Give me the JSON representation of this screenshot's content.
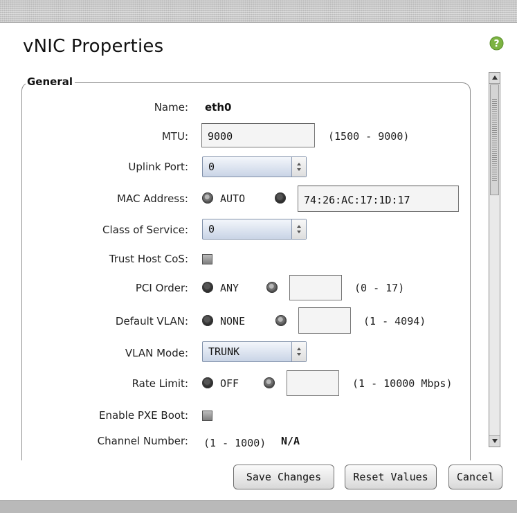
{
  "dialog": {
    "title": "vNIC Properties",
    "help_icon": "question-circle-icon"
  },
  "section": {
    "legend": "General"
  },
  "fields": {
    "name": {
      "label": "Name:",
      "value": "eth0"
    },
    "mtu": {
      "label": "MTU:",
      "value": "9000",
      "hint": "(1500 - 9000)"
    },
    "uplink_port": {
      "label": "Uplink Port:",
      "value": "0"
    },
    "mac_address": {
      "label": "MAC Address:",
      "option_auto": "AUTO",
      "auto_selected": false,
      "custom_selected": true,
      "value": "74:26:AC:17:1D:17"
    },
    "class_of_service": {
      "label": "Class of Service:",
      "value": "0"
    },
    "trust_host_cos": {
      "label": "Trust Host CoS:",
      "checked": false
    },
    "pci_order": {
      "label": "PCI Order:",
      "option_any": "ANY",
      "any_selected": true,
      "value": "",
      "hint": "(0 - 17)"
    },
    "default_vlan": {
      "label": "Default VLAN:",
      "option_none": "NONE",
      "none_selected": true,
      "value": "",
      "hint": "(1 - 4094)"
    },
    "vlan_mode": {
      "label": "VLAN Mode:",
      "value": "TRUNK"
    },
    "rate_limit": {
      "label": "Rate Limit:",
      "option_off": "OFF",
      "off_selected": true,
      "value": "",
      "hint": "(1 - 10000 Mbps)"
    },
    "enable_pxe_boot": {
      "label": "Enable PXE Boot:",
      "checked": false
    },
    "channel_number": {
      "label": "Channel Number:",
      "hint": "(1 - 1000)",
      "value": "N/A"
    }
  },
  "buttons": {
    "save": "Save Changes",
    "reset": "Reset Values",
    "cancel": "Cancel"
  },
  "colors": {
    "help_green": "#7cb342",
    "topbar": "#c8c8c8",
    "select_blue": "#c9d4e6"
  }
}
